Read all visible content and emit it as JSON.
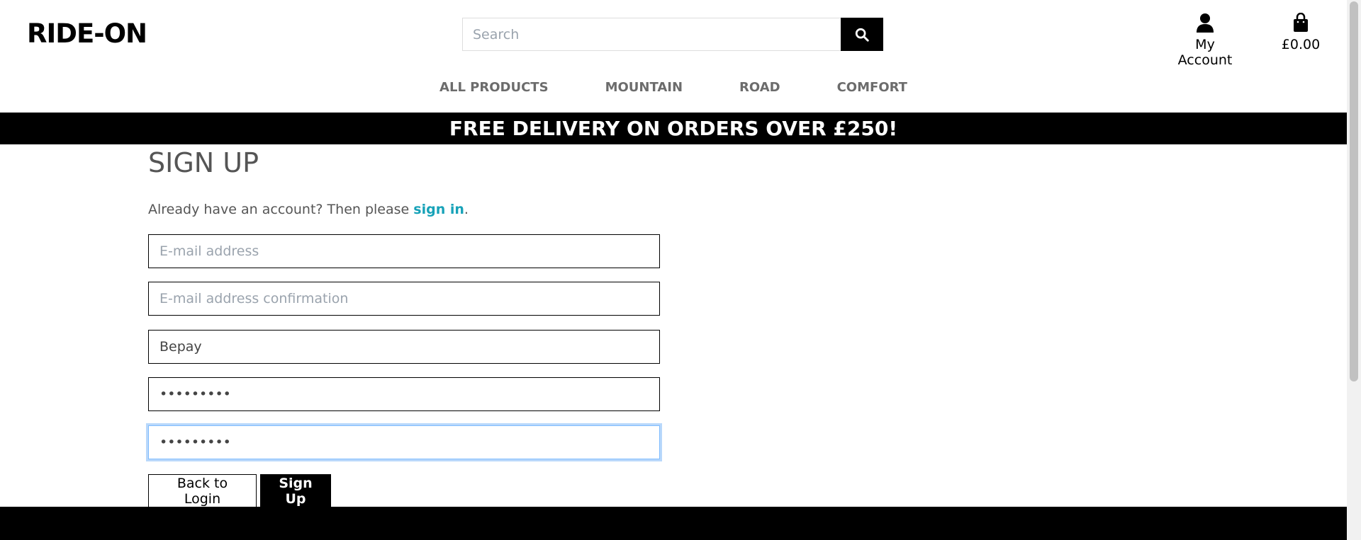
{
  "header": {
    "logo": "RIDE-ON",
    "search": {
      "placeholder": "Search"
    },
    "account_label": "My Account",
    "bag_total": "£0.00"
  },
  "nav": {
    "items": [
      "ALL PRODUCTS",
      "MOUNTAIN",
      "ROAD",
      "COMFORT"
    ]
  },
  "banner": {
    "text": "FREE DELIVERY ON ORDERS OVER £250!"
  },
  "form": {
    "title": "SIGN UP",
    "already_text": "Already have an account? Then please ",
    "signin_link": "sign in",
    "already_suffix": ".",
    "email_placeholder": "E-mail address",
    "email_confirm_placeholder": "E-mail address confirmation",
    "username_value": "Bepay",
    "password_value": "•••••••••",
    "password2_value": "•••••••••",
    "back_label": "Back to Login",
    "signup_label": "Sign Up"
  },
  "colors": {
    "link": "#17a2b8",
    "banner_bg": "#000000",
    "focus_ring": "#b9d8fb"
  }
}
